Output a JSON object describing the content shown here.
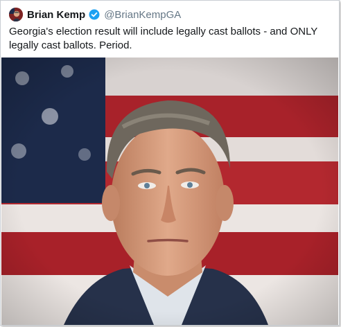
{
  "tweet": {
    "display_name": "Brian Kemp",
    "handle": "@BrianKempGA",
    "verified": true,
    "text": "Georgia's election result will include legally cast ballots - and ONLY legally cast ballots. Period."
  },
  "icons": {
    "verified": "verified-badge-icon",
    "avatar": "profile-avatar"
  },
  "colors": {
    "name": "#14171a",
    "handle": "#657786",
    "verified": "#1da1f2",
    "flag_red": "#a8222a",
    "flag_blue": "#1c2a4a"
  }
}
